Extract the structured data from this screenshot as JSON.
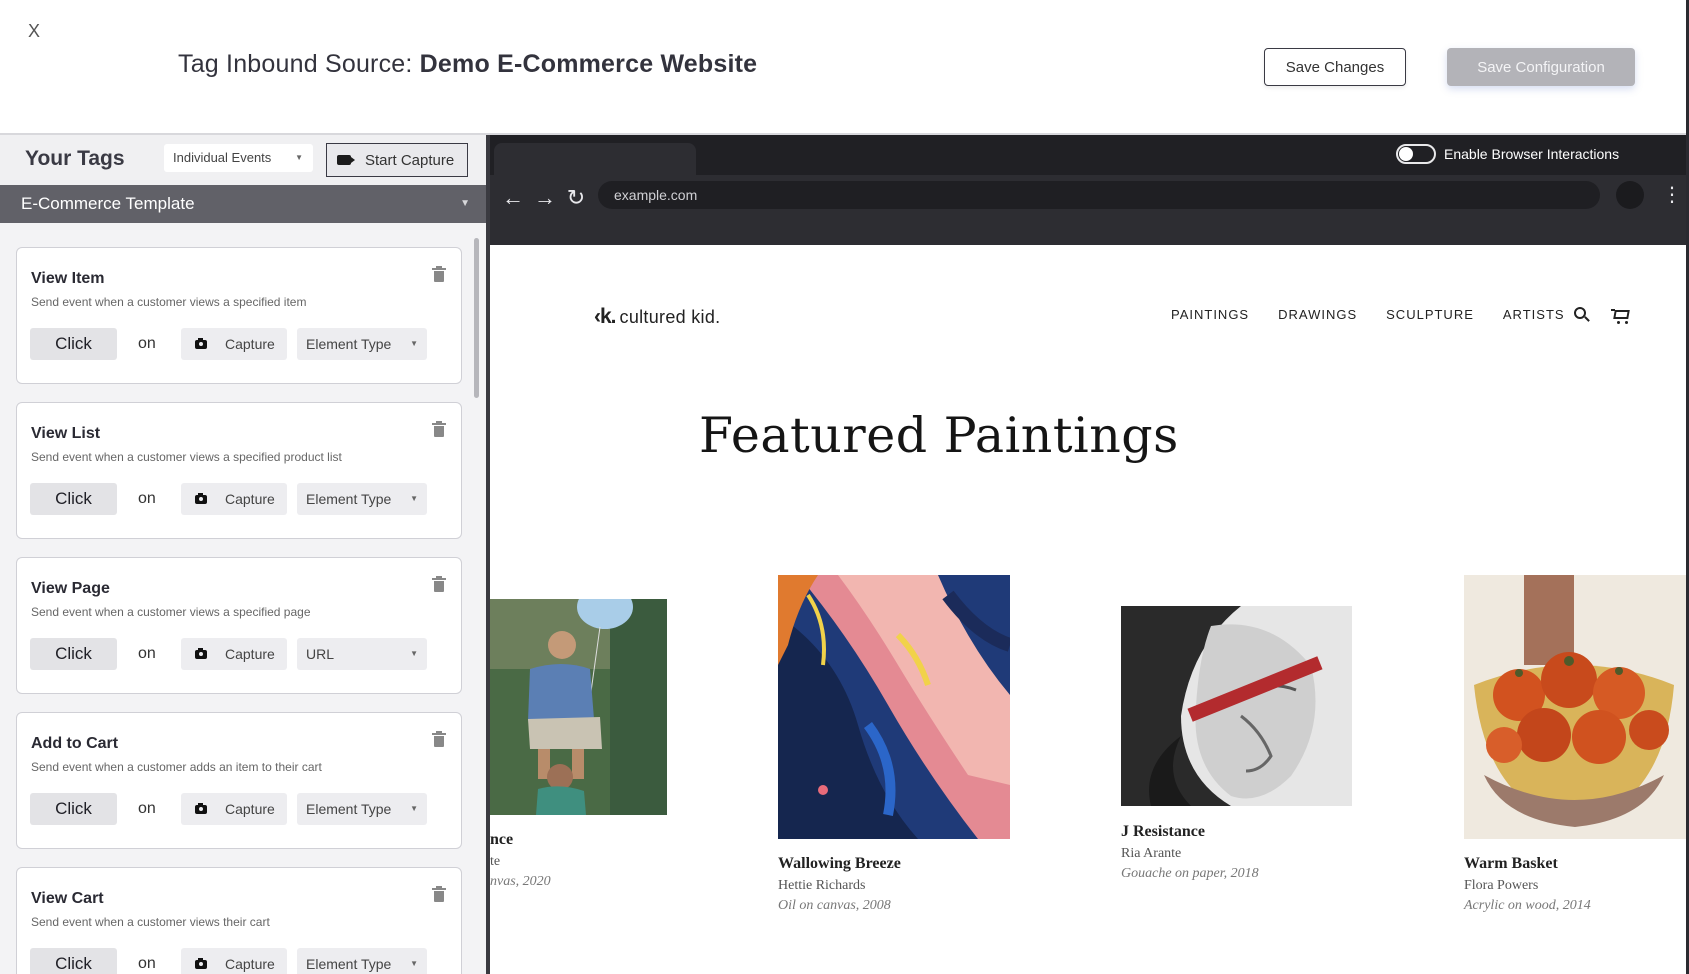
{
  "header": {
    "close_label": "X",
    "title_prefix": "Tag Inbound Source: ",
    "title_source": "Demo E-Commerce Website",
    "save_changes": "Save Changes",
    "save_configuration": "Save Configuration"
  },
  "sidebar": {
    "title": "Your Tags",
    "event_mode": "Individual Events",
    "start_capture": "Start Capture",
    "template": "E-Commerce Template",
    "cards": [
      {
        "title": "View Item",
        "desc": "Send event when a customer views a specified item",
        "action": "Click",
        "on": "on",
        "capture": "Capture",
        "type": "Element Type"
      },
      {
        "title": "View List",
        "desc": "Send event when a customer views a specified product list",
        "action": "Click",
        "on": "on",
        "capture": "Capture",
        "type": "Element Type"
      },
      {
        "title": "View Page",
        "desc": "Send event when a customer views a specified page",
        "action": "Click",
        "on": "on",
        "capture": "Capture",
        "type": "URL"
      },
      {
        "title": "Add to Cart",
        "desc": "Send event when a customer adds an item to their cart",
        "action": "Click",
        "on": "on",
        "capture": "Capture",
        "type": "Element Type"
      },
      {
        "title": "View Cart",
        "desc": "Send event when a customer views their cart",
        "action": "Click",
        "on": "on",
        "capture": "Capture",
        "type": "Element Type"
      }
    ]
  },
  "browser": {
    "toggle_label": "Enable Browser Interactions",
    "url": "example.com"
  },
  "site": {
    "logo_mark": "‹k.",
    "logo_text": "cultured kid.",
    "nav": [
      "PAINTINGS",
      "DRAWINGS",
      "SCULPTURE",
      "ARTISTS"
    ],
    "heading": "Featured Paintings",
    "artworks": [
      {
        "name": "nce",
        "artist": "te",
        "medium": "nvas, 2020"
      },
      {
        "name": "Wallowing Breeze",
        "artist": "Hettie Richards",
        "medium": "Oil on canvas, 2008"
      },
      {
        "name": "J Resistance",
        "artist": "Ria Arante",
        "medium": "Gouache on paper, 2018"
      },
      {
        "name": "Warm Basket",
        "artist": "Flora Powers",
        "medium": "Acrylic on wood, 2014"
      }
    ]
  },
  "colors": {
    "sidebar_bg": "#f3f3f5",
    "template_bar": "#616168",
    "browser_chrome": "#2d2d32",
    "disabled_button": "#b3b3b8"
  }
}
